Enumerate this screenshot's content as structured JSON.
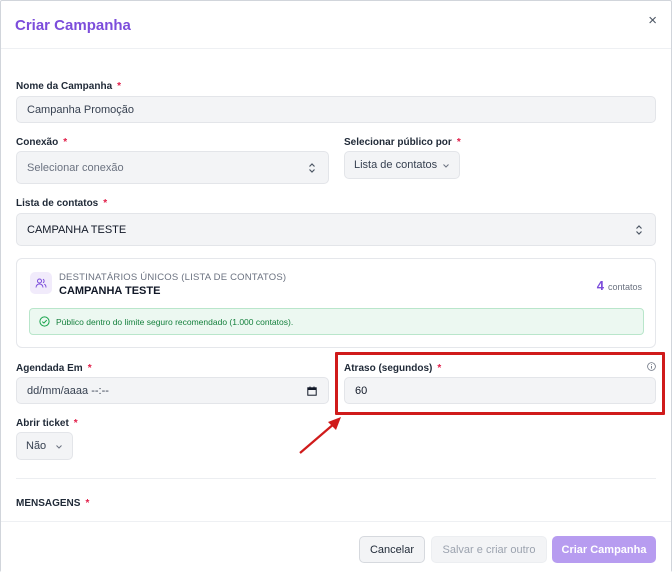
{
  "modal": {
    "title": "Criar Campanha",
    "close_label": "×"
  },
  "form": {
    "campaign_name": {
      "label": "Nome da Campanha",
      "required": "*",
      "value": "Campanha Promoção"
    },
    "connection": {
      "label": "Conexão",
      "required": "*",
      "placeholder": "Selecionar conexão"
    },
    "audience_by": {
      "label": "Selecionar público por",
      "required": "*",
      "value": "Lista de contatos"
    },
    "contact_list": {
      "label": "Lista de contatos",
      "required": "*",
      "value": "CAMPANHA TESTE"
    },
    "scheduled": {
      "label": "Agendada Em",
      "required": "*",
      "value": "dd/mm/aaaa --:--"
    },
    "delay": {
      "label": "Atraso (segundos)",
      "required": "*",
      "value": "60"
    },
    "open_ticket": {
      "label": "Abrir ticket",
      "required": "*",
      "value": "Não"
    },
    "messages": {
      "label": "MENSAGENS",
      "required": "*"
    }
  },
  "recipients": {
    "subtitle": "DESTINATÁRIOS ÚNICOS (LISTA DE CONTATOS)",
    "list_name": "CAMPANHA TESTE",
    "count": "4",
    "count_unit": "contatos",
    "alert": "Público dentro do limite seguro recomendado (1.000 contatos)."
  },
  "footer": {
    "cancel_label": "Cancelar",
    "save_new_label": "Salvar e criar outro",
    "create_label": "Criar Campanha"
  },
  "colors": {
    "accent": "#7c4ddb",
    "highlight": "#d01b1b",
    "success": "#15803d"
  }
}
